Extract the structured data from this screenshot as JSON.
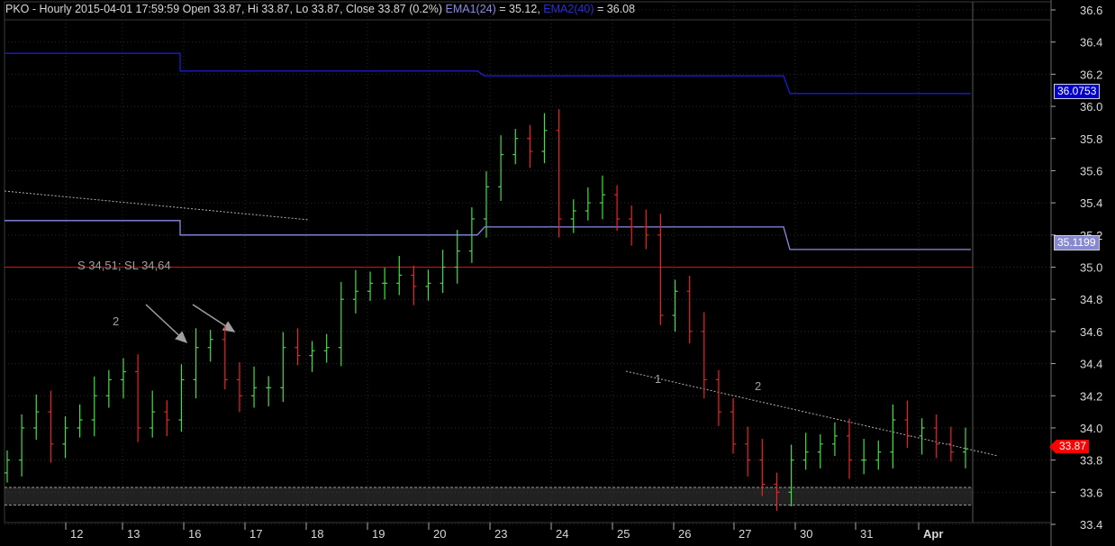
{
  "header": {
    "title": "PKO - Hourly 2015-04-01 17:59:59 Open 33.87, Hi 33.87, Lo 33.87, Close 33.87 (0.2%)",
    "ema1_label": "EMA1(24)",
    "ema1_eq": " = 35.12,",
    "ema2_label": "EMA2(40)",
    "ema2_eq": " = 36.08"
  },
  "badges": {
    "ema2": "36.0753",
    "ema1": "35.1199",
    "last": "33.87"
  },
  "annotations": {
    "signal_text": "S 34,51; SL 34,64",
    "wave_labels": [
      "2",
      "1",
      "2"
    ]
  },
  "colors": {
    "background": "#000000",
    "up_bar": "#44dd44",
    "down_bar": "#ee2222",
    "ema1": "#8a8ae6",
    "ema2": "#1c1cd0",
    "level_line": "#e01010",
    "trendline": "#b0b0b0",
    "grid": "#2a2a2a",
    "axis_text": "#d8d8d8"
  },
  "chart_data": {
    "type": "line",
    "title": "PKO - Hourly",
    "x_labels": [
      "12",
      "13",
      "16",
      "17",
      "18",
      "19",
      "20",
      "23",
      "24",
      "25",
      "26",
      "27",
      "30",
      "31",
      "Apr"
    ],
    "y_ticks": [
      33.4,
      33.6,
      33.8,
      34.0,
      34.2,
      34.4,
      34.6,
      34.8,
      35.0,
      35.2,
      35.4,
      35.6,
      35.8,
      36.0,
      36.2,
      36.4,
      36.6
    ],
    "ylim": [
      33.35,
      36.65
    ],
    "grid": true,
    "price_axis": "right",
    "horizontal_level": 35.0,
    "support_band": [
      33.52,
      33.63
    ],
    "series": [
      {
        "name": "EMA1(24)",
        "points": [
          [
            "10",
            35.29
          ],
          [
            "16",
            35.29
          ],
          [
            "16",
            35.2
          ],
          [
            "22",
            35.2
          ],
          [
            "23",
            35.25
          ],
          [
            "28",
            35.25
          ],
          [
            "30",
            35.11
          ],
          [
            "Apr",
            35.11
          ]
        ]
      },
      {
        "name": "EMA2(40)",
        "points": [
          [
            "10",
            36.33
          ],
          [
            "16",
            36.33
          ],
          [
            "16",
            36.22
          ],
          [
            "22",
            36.22
          ],
          [
            "23",
            36.19
          ],
          [
            "28",
            36.19
          ],
          [
            "30",
            36.08
          ],
          [
            "Apr",
            36.08
          ]
        ]
      }
    ],
    "price_bars_close": [
      33.8,
      34.0,
      34.1,
      33.9,
      34.0,
      34.05,
      34.2,
      34.3,
      34.35,
      34.0,
      34.1,
      34.05,
      34.3,
      34.5,
      34.55,
      34.3,
      34.2,
      34.25,
      34.25,
      34.5,
      34.45,
      34.48,
      34.5,
      34.8,
      34.85,
      34.9,
      34.9,
      34.95,
      34.88,
      34.9,
      35.0,
      35.1,
      35.3,
      35.5,
      35.7,
      35.8,
      35.72,
      35.85,
      35.3,
      35.35,
      35.4,
      35.45,
      35.3,
      35.25,
      35.2,
      34.7,
      34.85,
      34.6,
      34.3,
      34.1,
      33.9,
      33.8,
      33.65,
      33.6,
      33.8,
      33.85,
      33.9,
      33.95,
      33.8,
      33.8,
      33.85,
      34.05,
      33.95,
      34.0,
      33.9,
      33.85,
      33.87
    ],
    "last_close": 33.87
  }
}
